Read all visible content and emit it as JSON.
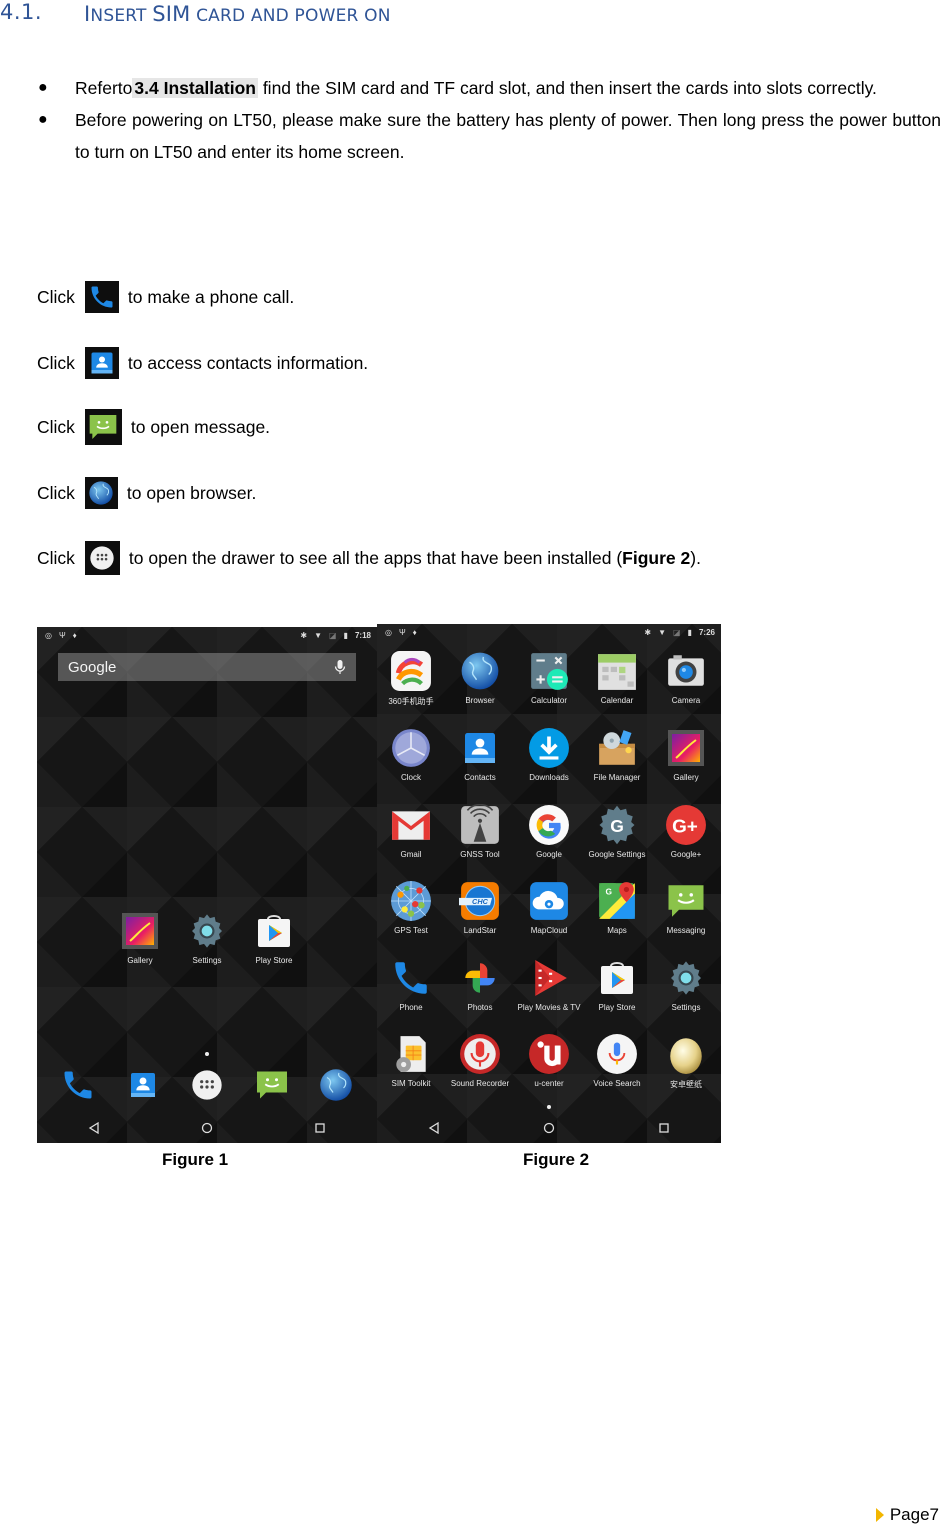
{
  "heading": {
    "number": "4.1.",
    "title_parts": [
      "I",
      "NSERT ",
      "SIM",
      " C",
      "ARD AND POWER ON"
    ]
  },
  "bullets": [
    {
      "prefix": "Referto",
      "ref": "3.4 Installation",
      "suffix": " find the SIM card and TF card slot, and then insert the cards into slots correctly."
    },
    {
      "text": "Before powering on LT50, please make sure the battery has plenty of power. Then long press the power button to turn on LT50 and enter its home screen."
    }
  ],
  "click_instructions": [
    {
      "label": "Click",
      "icon": "phone-icon",
      "text": "to make a phone call."
    },
    {
      "label": "Click",
      "icon": "contacts-icon",
      "text": "to access contacts information."
    },
    {
      "label": "Click",
      "icon": "messaging-icon",
      "text": "to open message."
    },
    {
      "label": "Click",
      "icon": "browser-icon",
      "text": "to open browser."
    },
    {
      "label": "Click",
      "icon": "app-drawer-icon",
      "text_before": "to open the drawer to see all the apps that have been installed (",
      "bold": "Figure 2",
      "text_after": ")."
    }
  ],
  "figure1": {
    "status_time": "7:18",
    "search_label": "Google",
    "home_apps": [
      {
        "label": "Gallery",
        "icon": "gallery-icon"
      },
      {
        "label": "Settings",
        "icon": "settings-icon"
      },
      {
        "label": "Play Store",
        "icon": "play-store-icon"
      }
    ],
    "dock": [
      "phone-icon",
      "contacts-icon",
      "app-drawer-icon",
      "messaging-icon",
      "browser-icon"
    ],
    "caption": "Figure 1"
  },
  "figure2": {
    "status_time": "7:26",
    "apps": [
      {
        "label": "360手机助手",
        "icon": "360-assistant-icon"
      },
      {
        "label": "Browser",
        "icon": "browser-icon"
      },
      {
        "label": "Calculator",
        "icon": "calculator-icon"
      },
      {
        "label": "Calendar",
        "icon": "calendar-icon"
      },
      {
        "label": "Camera",
        "icon": "camera-icon"
      },
      {
        "label": "Clock",
        "icon": "clock-icon"
      },
      {
        "label": "Contacts",
        "icon": "contacts-icon"
      },
      {
        "label": "Downloads",
        "icon": "downloads-icon"
      },
      {
        "label": "File Manager",
        "icon": "file-manager-icon"
      },
      {
        "label": "Gallery",
        "icon": "gallery-icon"
      },
      {
        "label": "Gmail",
        "icon": "gmail-icon"
      },
      {
        "label": "GNSS Tool",
        "icon": "gnss-tool-icon"
      },
      {
        "label": "Google",
        "icon": "google-icon"
      },
      {
        "label": "Google Settings",
        "icon": "google-settings-icon"
      },
      {
        "label": "Google+",
        "icon": "google-plus-icon"
      },
      {
        "label": "GPS Test",
        "icon": "gps-test-icon"
      },
      {
        "label": "LandStar",
        "icon": "landstar-icon"
      },
      {
        "label": "MapCloud",
        "icon": "mapcloud-icon"
      },
      {
        "label": "Maps",
        "icon": "maps-icon"
      },
      {
        "label": "Messaging",
        "icon": "messaging-icon"
      },
      {
        "label": "Phone",
        "icon": "phone-icon"
      },
      {
        "label": "Photos",
        "icon": "photos-icon"
      },
      {
        "label": "Play Movies & TV",
        "icon": "play-movies-icon"
      },
      {
        "label": "Play Store",
        "icon": "play-store-icon"
      },
      {
        "label": "Settings",
        "icon": "settings-icon"
      },
      {
        "label": "SIM Toolkit",
        "icon": "sim-toolkit-icon"
      },
      {
        "label": "Sound Recorder",
        "icon": "sound-recorder-icon"
      },
      {
        "label": "u-center",
        "icon": "u-center-icon"
      },
      {
        "label": "Voice Search",
        "icon": "voice-search-icon"
      },
      {
        "label": "安卓壁纸",
        "icon": "wallpaper-icon"
      }
    ],
    "caption": "Figure 2"
  },
  "footer": {
    "page_label": "Page7"
  },
  "colors": {
    "heading": "#2f5496",
    "footer_marker": "#f2b600",
    "ref_highlight": "#e6e6e6"
  }
}
